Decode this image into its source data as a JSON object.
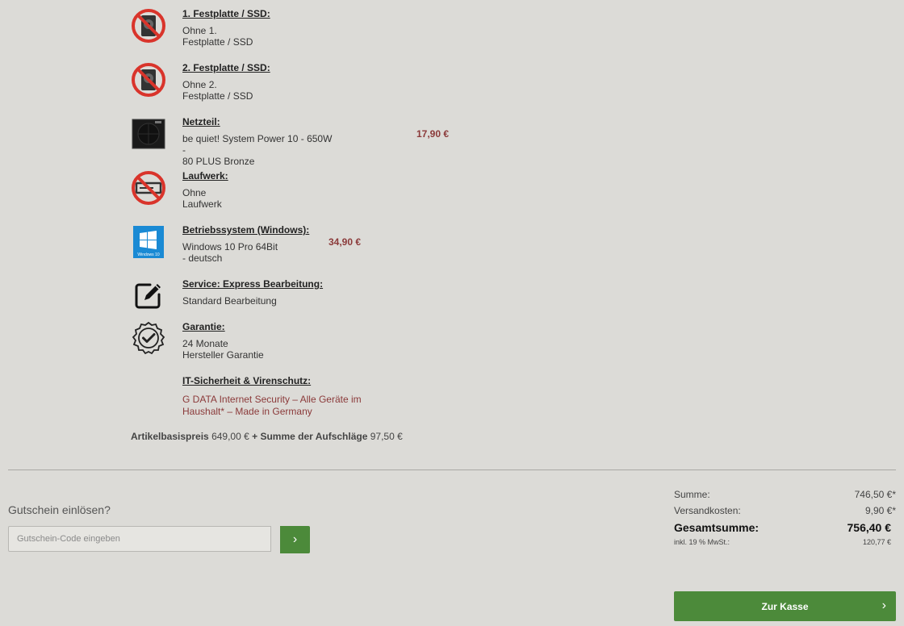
{
  "config": {
    "items": [
      {
        "label": "1. Festplatte / SSD:",
        "value": "Ohne 1.\nFestplatte / SSD",
        "price": "",
        "icon": "no-harddisk-icon"
      },
      {
        "label": "2. Festplatte / SSD:",
        "value": "Ohne 2.\nFestplatte / SSD",
        "price": "",
        "icon": "no-harddisk-icon"
      },
      {
        "label": "Netzteil:",
        "value": "be quiet! System Power 10 - 650W -\n80 PLUS Bronze",
        "price": "17,90 €",
        "icon": "power-supply-icon"
      },
      {
        "label": "Laufwerk:",
        "value": "Ohne\nLaufwerk",
        "price": "",
        "icon": "no-drive-icon"
      },
      {
        "label": "Betriebssystem (Windows):",
        "value": "Windows 10 Pro 64Bit\n- deutsch",
        "price": "34,90 €",
        "icon": "windows-10-icon",
        "icon_text": "Windows 10"
      },
      {
        "label": "Service: Express Bearbeitung:",
        "value": "Standard Bearbeitung",
        "price": "",
        "icon": "edit-icon"
      },
      {
        "label": "Garantie:",
        "value": "24 Monate\nHersteller Garantie",
        "price": "",
        "icon": "warranty-check-icon"
      },
      {
        "label": "IT-Sicherheit & Virenschutz:",
        "value": "G DATA Internet Security – Alle Geräte im\nHaushalt* – Made in Germany",
        "price": "",
        "icon": ""
      }
    ],
    "summary": {
      "base_label": "Artikelbasispreis",
      "base_value": "649,00 €",
      "surcharge_label": "+ Summe der Aufschläge",
      "surcharge_value": "97,50 €"
    }
  },
  "voucher": {
    "title": "Gutschein einlösen?",
    "placeholder": "Gutschein-Code eingeben",
    "submit_label": "›"
  },
  "totals": {
    "sum_label": "Summe:",
    "sum_value": "746,50 €*",
    "shipping_label": "Versandkosten:",
    "shipping_value": "9,90 €*",
    "total_label": "Gesamtsumme:",
    "total_value": "756,40 €",
    "vat_label": "inkl. 19 % MwSt.:",
    "vat_value": "120,77 €"
  },
  "checkout": {
    "label": "Zur Kasse",
    "chevron": "›"
  },
  "colors": {
    "accent_green": "#4c8a3a",
    "price_red": "#8b3a3a",
    "background": "#dcdbd7",
    "forbidden_red": "#d9342b",
    "windows_blue": "#1a8ad4"
  }
}
